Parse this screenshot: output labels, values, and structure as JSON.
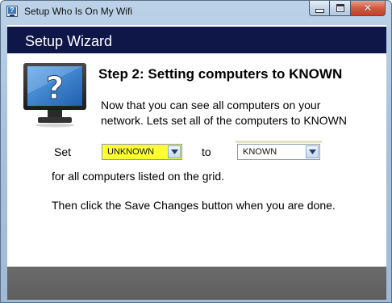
{
  "window": {
    "title": "Setup Who Is On My Wifi",
    "minimize_icon": "minimize-icon",
    "maximize_icon": "maximize-icon",
    "close_icon": "close-icon",
    "close_glyph": "✕"
  },
  "header": {
    "title": "Setup Wizard"
  },
  "illustration": {
    "icon": "monitor-question-icon",
    "glyph": "?"
  },
  "step": {
    "title": "Step 2: Setting computers to KNOWN",
    "intro_line1": "Now that you can see all computers on your",
    "intro_line2": "network.  Lets set all of the computers to KNOWN"
  },
  "assignment": {
    "set_label": "Set",
    "from_value": "UNKNOWN",
    "to_label": "to",
    "to_value": "KNOWN",
    "grid_text": "for all computers listed on the grid."
  },
  "instructions": {
    "save_text": "Then click the Save Changes button when you are done."
  },
  "colors": {
    "header_band": "#0f1748",
    "footer_band": "#636363",
    "highlight_select": "#ffff33"
  }
}
